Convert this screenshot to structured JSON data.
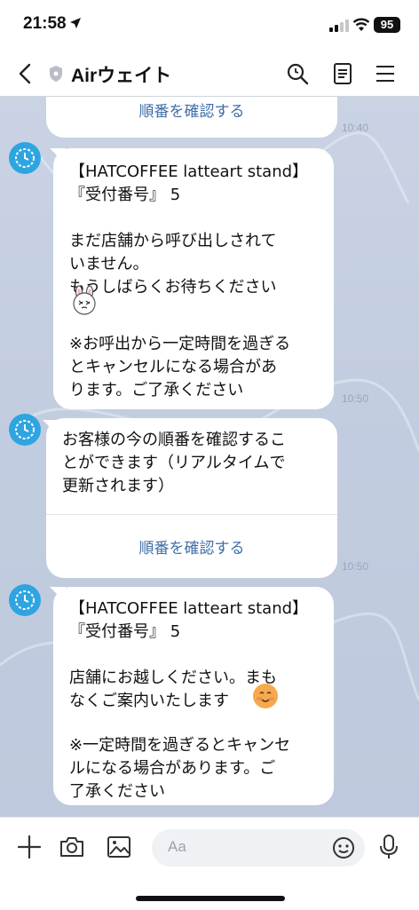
{
  "status": {
    "time": "21:58",
    "battery": "95"
  },
  "nav": {
    "title": "Airウェイト"
  },
  "messages": [
    {
      "button_label": "順番を確認する",
      "timestamp": "10:40"
    },
    {
      "text": "【HATCOFFEE latteart stand】\n『受付番号』 5\n\nまだ店舗から呼び出しされて\nいません。\nもうしばらくお待ちください",
      "text2": "※お呼出から一定時間を過ぎる\nとキャンセルになる場合があ\nります。ご了承ください",
      "timestamp": "10:50"
    },
    {
      "text": "お客様の今の順番を確認するこ\nとができます（リアルタイムで\n更新されます）",
      "button_label": "順番を確認する",
      "timestamp": "10:50"
    },
    {
      "text": "【HATCOFFEE latteart stand】\n『受付番号』 5\n\n店舗にお越しください。まも\nなくご案内いたします",
      "text2": "※一定時間を過ぎるとキャンセ\nルになる場合があります。ご\n了承ください"
    }
  ],
  "input": {
    "placeholder": "Aa"
  },
  "icons": [
    "location-arrow-icon",
    "signal-icon",
    "wifi-icon",
    "back-icon",
    "shield-icon",
    "search-icon",
    "notes-icon",
    "menu-icon",
    "clock-icon",
    "rabbit-sticker",
    "smile-emoji",
    "plus-icon",
    "camera-icon",
    "image-icon",
    "emoji-icon",
    "mic-icon"
  ]
}
